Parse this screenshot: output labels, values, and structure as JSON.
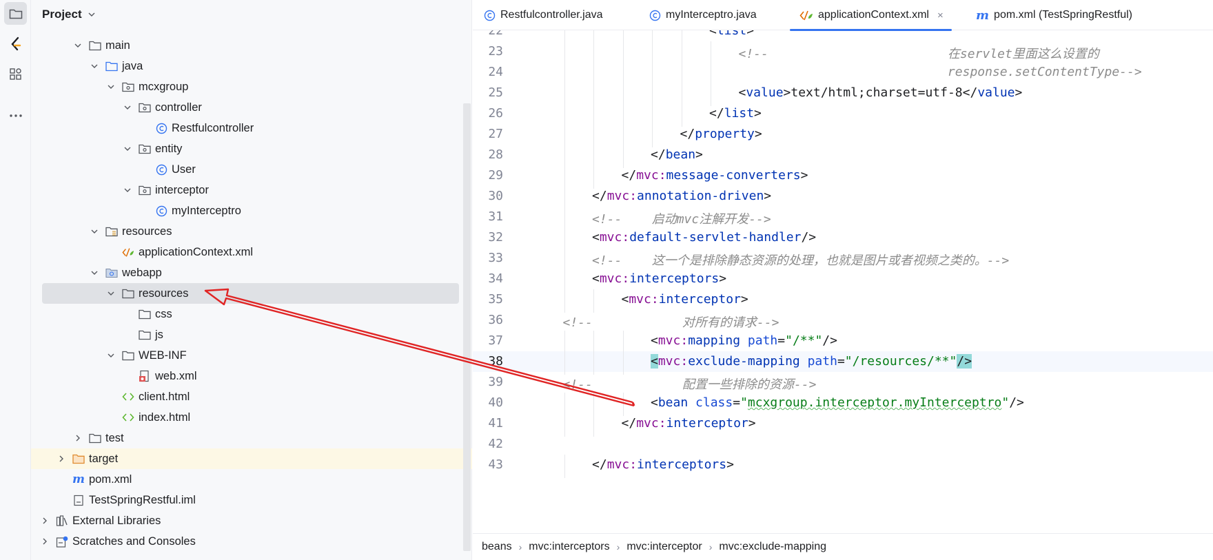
{
  "project_panel": {
    "title": "Project",
    "tree": [
      {
        "label": "main",
        "depth": 3,
        "expanded": true,
        "icon": "folder-icon"
      },
      {
        "label": "java",
        "depth": 4,
        "expanded": true,
        "icon": "source-folder-icon"
      },
      {
        "label": "mcxgroup",
        "depth": 5,
        "expanded": true,
        "icon": "package-icon"
      },
      {
        "label": "controller",
        "depth": 6,
        "expanded": true,
        "icon": "package-icon"
      },
      {
        "label": "Restfulcontroller",
        "depth": 7,
        "expanded": null,
        "icon": "java-class-icon"
      },
      {
        "label": "entity",
        "depth": 6,
        "expanded": true,
        "icon": "package-icon"
      },
      {
        "label": "User",
        "depth": 7,
        "expanded": null,
        "icon": "java-class-icon"
      },
      {
        "label": "interceptor",
        "depth": 6,
        "expanded": true,
        "icon": "package-icon"
      },
      {
        "label": "myInterceptro",
        "depth": 7,
        "expanded": null,
        "icon": "java-class-icon"
      },
      {
        "label": "resources",
        "depth": 4,
        "expanded": true,
        "icon": "resources-folder-icon"
      },
      {
        "label": "applicationContext.xml",
        "depth": 5,
        "expanded": null,
        "icon": "spring-xml-icon"
      },
      {
        "label": "webapp",
        "depth": 4,
        "expanded": true,
        "icon": "web-folder-icon"
      },
      {
        "label": "resources",
        "depth": 5,
        "expanded": true,
        "icon": "folder-icon",
        "selected": true
      },
      {
        "label": "css",
        "depth": 6,
        "expanded": null,
        "icon": "folder-icon"
      },
      {
        "label": "js",
        "depth": 6,
        "expanded": null,
        "icon": "folder-icon"
      },
      {
        "label": "WEB-INF",
        "depth": 5,
        "expanded": true,
        "icon": "folder-icon"
      },
      {
        "label": "web.xml",
        "depth": 6,
        "expanded": null,
        "icon": "web-xml-icon"
      },
      {
        "label": "client.html",
        "depth": 5,
        "expanded": null,
        "icon": "html-icon"
      },
      {
        "label": "index.html",
        "depth": 5,
        "expanded": null,
        "icon": "html-icon"
      },
      {
        "label": "test",
        "depth": 3,
        "expanded": false,
        "icon": "folder-icon"
      },
      {
        "label": "target",
        "depth": 2,
        "expanded": false,
        "icon": "excluded-folder-icon",
        "highlight": true
      },
      {
        "label": "pom.xml",
        "depth": 2,
        "expanded": null,
        "icon": "maven-icon"
      },
      {
        "label": "TestSpringRestful.iml",
        "depth": 2,
        "expanded": null,
        "icon": "module-file-icon"
      },
      {
        "label": "External Libraries",
        "depth": 1,
        "expanded": false,
        "icon": "library-icon"
      },
      {
        "label": "Scratches and Consoles",
        "depth": 1,
        "expanded": false,
        "icon": "scratches-icon"
      }
    ]
  },
  "tabs": [
    {
      "label": "Restfulcontroller.java",
      "icon": "java-class-icon",
      "active": false
    },
    {
      "label": "myInterceptro.java",
      "icon": "java-class-icon",
      "active": false
    },
    {
      "label": "applicationContext.xml",
      "icon": "spring-xml-icon",
      "active": true,
      "close": "×"
    },
    {
      "label": "pom.xml (TestSpringRestful)",
      "icon": "maven-icon",
      "active": false
    }
  ],
  "code_lines": [
    {
      "n": "22",
      "indent": 6,
      "tokens": [
        [
          "br",
          "<"
        ],
        [
          "tag",
          "list"
        ],
        [
          "br",
          ">"
        ]
      ]
    },
    {
      "n": "23",
      "indent": 7,
      "tokens": [
        [
          "com",
          "<!--                        在servlet里面这么设置的"
        ]
      ]
    },
    {
      "n": "24",
      "indent": 7,
      "tokens": [
        [
          "com",
          "                            response.setContentType-->"
        ]
      ]
    },
    {
      "n": "25",
      "indent": 7,
      "tokens": [
        [
          "br",
          "<"
        ],
        [
          "tag",
          "value"
        ],
        [
          "br",
          ">"
        ],
        [
          "txt",
          "text/html;charset=utf-8"
        ],
        [
          "br",
          "</"
        ],
        [
          "tag",
          "value"
        ],
        [
          "br",
          ">"
        ]
      ]
    },
    {
      "n": "26",
      "indent": 6,
      "tokens": [
        [
          "br",
          "</"
        ],
        [
          "tag",
          "list"
        ],
        [
          "br",
          ">"
        ]
      ]
    },
    {
      "n": "27",
      "indent": 5,
      "tokens": [
        [
          "br",
          "</"
        ],
        [
          "tag",
          "property"
        ],
        [
          "br",
          ">"
        ]
      ]
    },
    {
      "n": "28",
      "indent": 4,
      "tokens": [
        [
          "br",
          "</"
        ],
        [
          "tag",
          "bean"
        ],
        [
          "br",
          ">"
        ]
      ]
    },
    {
      "n": "29",
      "indent": 3,
      "tokens": [
        [
          "br",
          "</"
        ],
        [
          "ns",
          "mvc:"
        ],
        [
          "tag",
          "message-converters"
        ],
        [
          "br",
          ">"
        ]
      ]
    },
    {
      "n": "30",
      "indent": 2,
      "tokens": [
        [
          "br",
          "</"
        ],
        [
          "ns",
          "mvc:"
        ],
        [
          "tag",
          "annotation-driven"
        ],
        [
          "br",
          ">"
        ]
      ]
    },
    {
      "n": "31",
      "indent": 2,
      "tokens": [
        [
          "com",
          "<!--    启动mvc注解开发-->"
        ]
      ]
    },
    {
      "n": "32",
      "indent": 2,
      "tokens": [
        [
          "br",
          "<"
        ],
        [
          "ns",
          "mvc:"
        ],
        [
          "tag",
          "default-servlet-handler"
        ],
        [
          "br",
          "/>"
        ]
      ]
    },
    {
      "n": "33",
      "indent": 2,
      "tokens": [
        [
          "com",
          "<!--    这一个是排除静态资源的处理，也就是图片或者视频之类的。-->"
        ]
      ]
    },
    {
      "n": "34",
      "indent": 2,
      "tokens": [
        [
          "br",
          "<"
        ],
        [
          "ns",
          "mvc:"
        ],
        [
          "tag",
          "interceptors"
        ],
        [
          "br",
          ">"
        ]
      ]
    },
    {
      "n": "35",
      "indent": 3,
      "tokens": [
        [
          "br",
          "<"
        ],
        [
          "ns",
          "mvc:"
        ],
        [
          "tag",
          "interceptor"
        ],
        [
          "br",
          ">"
        ]
      ]
    },
    {
      "n": "36",
      "indent": 1,
      "tokens": [
        [
          "com",
          "<!--            对所有的请求-->"
        ]
      ]
    },
    {
      "n": "37",
      "indent": 4,
      "tokens": [
        [
          "br",
          "<"
        ],
        [
          "ns",
          "mvc:"
        ],
        [
          "tag",
          "mapping "
        ],
        [
          "attr",
          "path"
        ],
        [
          "br",
          "="
        ],
        [
          "str",
          "\"/**\""
        ],
        [
          "br",
          "/>"
        ]
      ]
    },
    {
      "n": "38",
      "indent": 4,
      "current": true,
      "tokens": [
        [
          "hl",
          "<"
        ],
        [
          "ns",
          "mvc:"
        ],
        [
          "tag",
          "exclude-mapping "
        ],
        [
          "attr",
          "path"
        ],
        [
          "br",
          "="
        ],
        [
          "str",
          "\"/resources/**\""
        ],
        [
          "hl",
          "/>"
        ]
      ]
    },
    {
      "n": "39",
      "indent": 1,
      "tokens": [
        [
          "com",
          "<!--            配置一些排除的资源-->"
        ]
      ]
    },
    {
      "n": "40",
      "indent": 4,
      "tokens": [
        [
          "br",
          "<"
        ],
        [
          "tag",
          "bean "
        ],
        [
          "attr",
          "class"
        ],
        [
          "br",
          "="
        ],
        [
          "str",
          "\""
        ],
        [
          "wavy",
          "mcxgroup.interceptor.myInterceptro"
        ],
        [
          "str",
          "\""
        ],
        [
          "br",
          "/>"
        ]
      ]
    },
    {
      "n": "41",
      "indent": 3,
      "tokens": [
        [
          "br",
          "</"
        ],
        [
          "ns",
          "mvc:"
        ],
        [
          "tag",
          "interceptor"
        ],
        [
          "br",
          ">"
        ]
      ]
    },
    {
      "n": "42",
      "indent": 0,
      "tokens": []
    },
    {
      "n": "43",
      "indent": 2,
      "tokens": [
        [
          "br",
          "</"
        ],
        [
          "ns",
          "mvc:"
        ],
        [
          "tag",
          "interceptors"
        ],
        [
          "br",
          ">"
        ]
      ]
    }
  ],
  "breadcrumbs": [
    "beans",
    "mvc:interceptors",
    "mvc:interceptor",
    "mvc:exclude-mapping"
  ],
  "colors": {
    "accent": "#3574f0",
    "annotation_arrow": "#e02424",
    "selection": "#dfe1e5",
    "current_line": "#f5f8fe",
    "brace_highlight": "#93d9d9"
  }
}
